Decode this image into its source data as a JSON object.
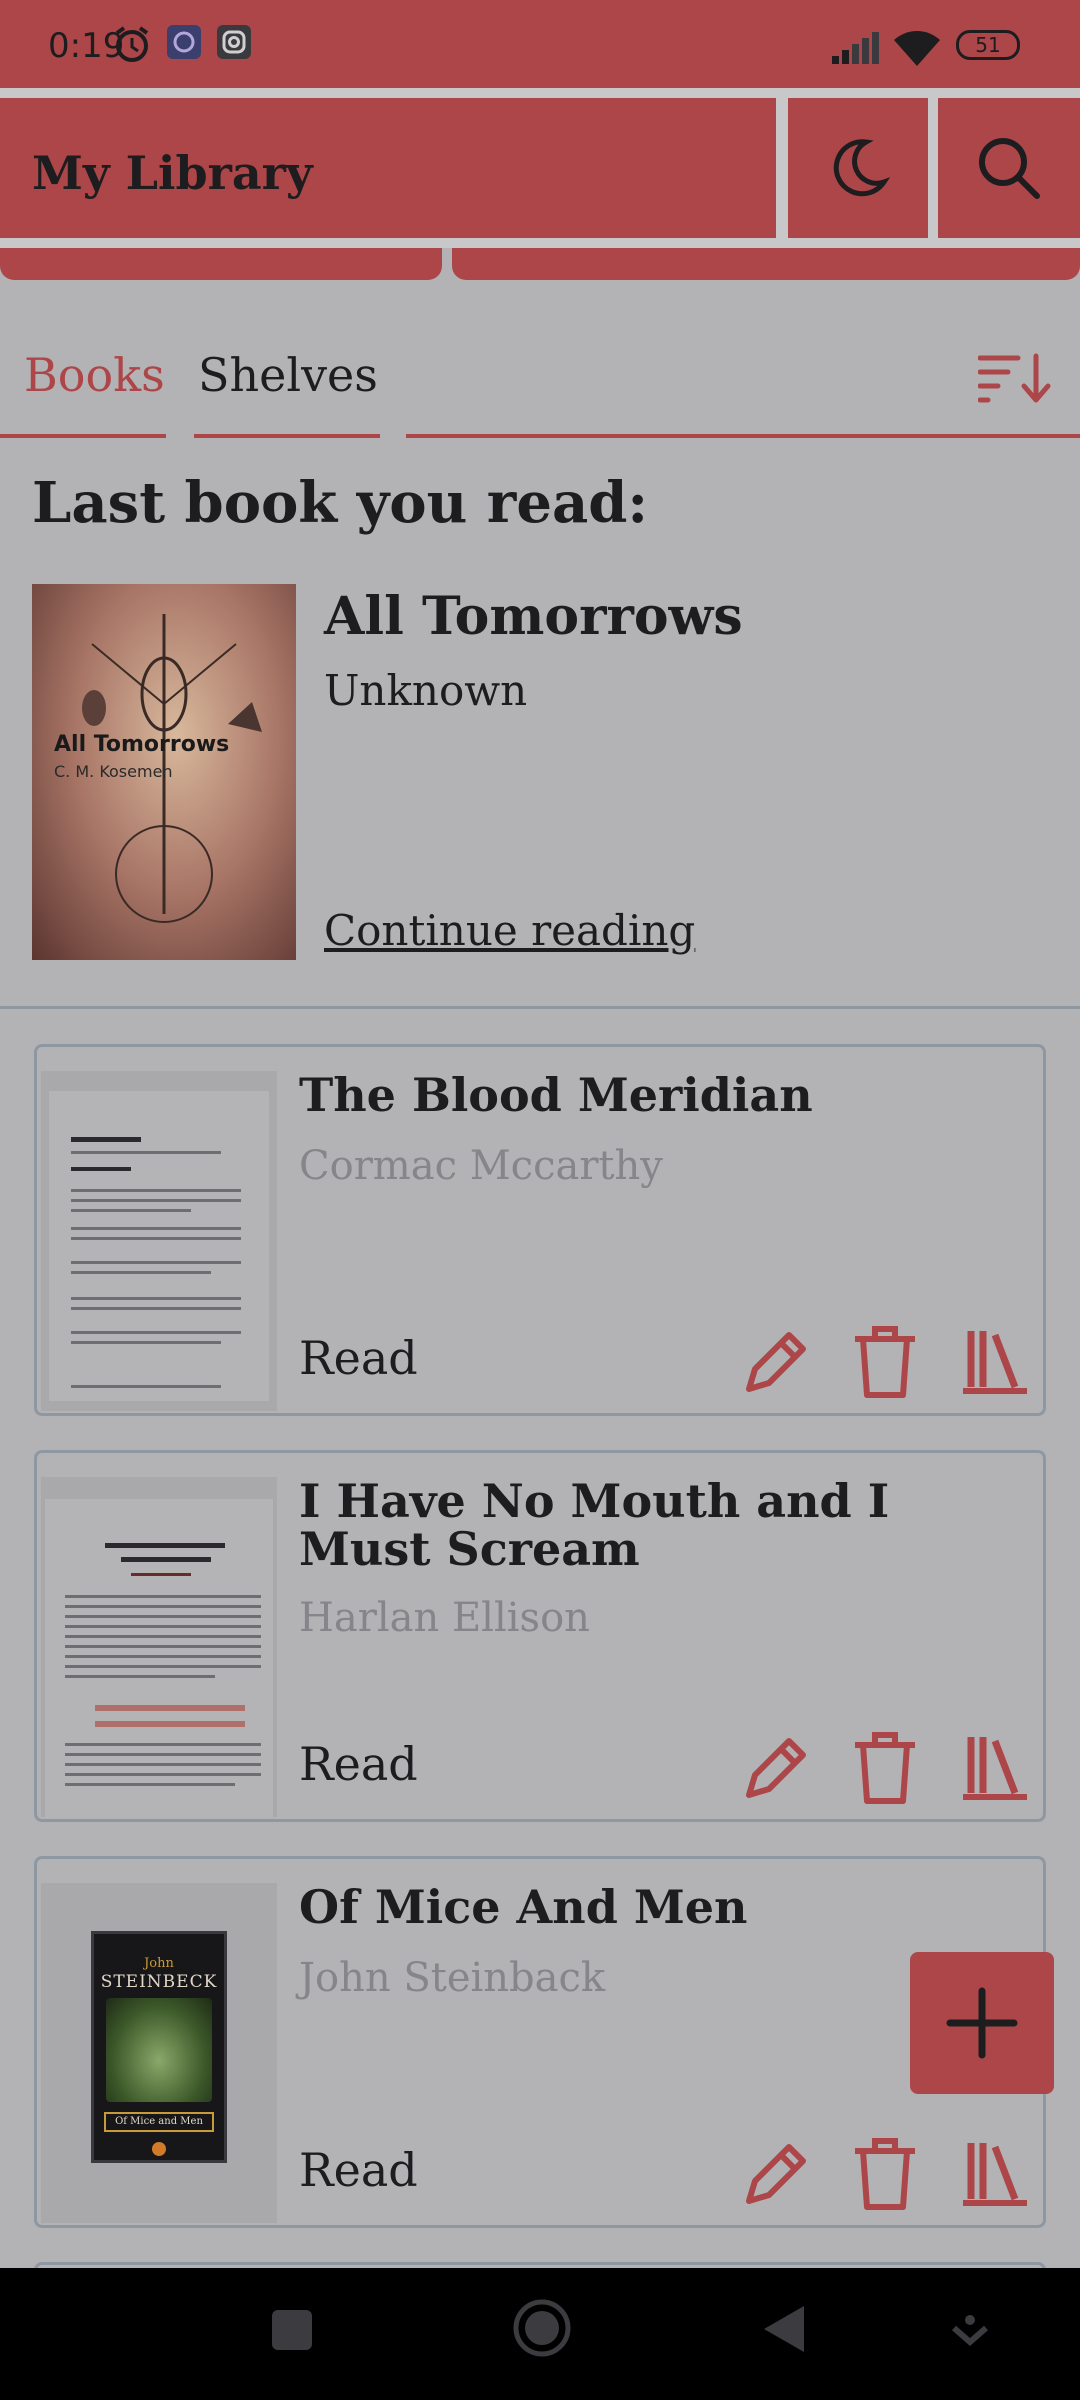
{
  "status_bar": {
    "time": "0:19",
    "battery": "51",
    "icons": [
      "alarm-icon",
      "viber-icon",
      "instagram-icon",
      "signal-icon",
      "wifi-icon",
      "battery-icon"
    ]
  },
  "app_bar": {
    "title": "My Library",
    "icons": [
      "moon-icon",
      "search-icon"
    ]
  },
  "tabs": [
    {
      "label": "Books",
      "active": true
    },
    {
      "label": "Shelves",
      "active": false
    }
  ],
  "sort_icon": "sort-icon",
  "last_read": {
    "heading": "Last book you read:",
    "cover_title": "All Tomorrows",
    "cover_author": "C. M. Kosemen",
    "title": "All Tomorrows",
    "author": "Unknown",
    "action": "Continue reading"
  },
  "books": [
    {
      "title": "The Blood Meridian",
      "author": "Cormac Mccarthy",
      "status": "Read"
    },
    {
      "title": "I Have No Mouth and I Must Scream",
      "author": "Harlan Ellison",
      "status": "Read"
    },
    {
      "title": "Of Mice And Men",
      "author": "John Steinback",
      "status": "Read"
    }
  ],
  "book_actions": [
    "edit-icon",
    "delete-icon",
    "shelf-icon"
  ],
  "fab_icon": "plus-icon",
  "nav_icons": [
    "recents-icon",
    "home-icon",
    "back-icon",
    "assistant-icon"
  ],
  "colors": {
    "accent": "#ad4648",
    "background": "#b3b3b6",
    "text": "#1d1d1f",
    "muted": "#85858a",
    "border": "#8e98a3"
  }
}
